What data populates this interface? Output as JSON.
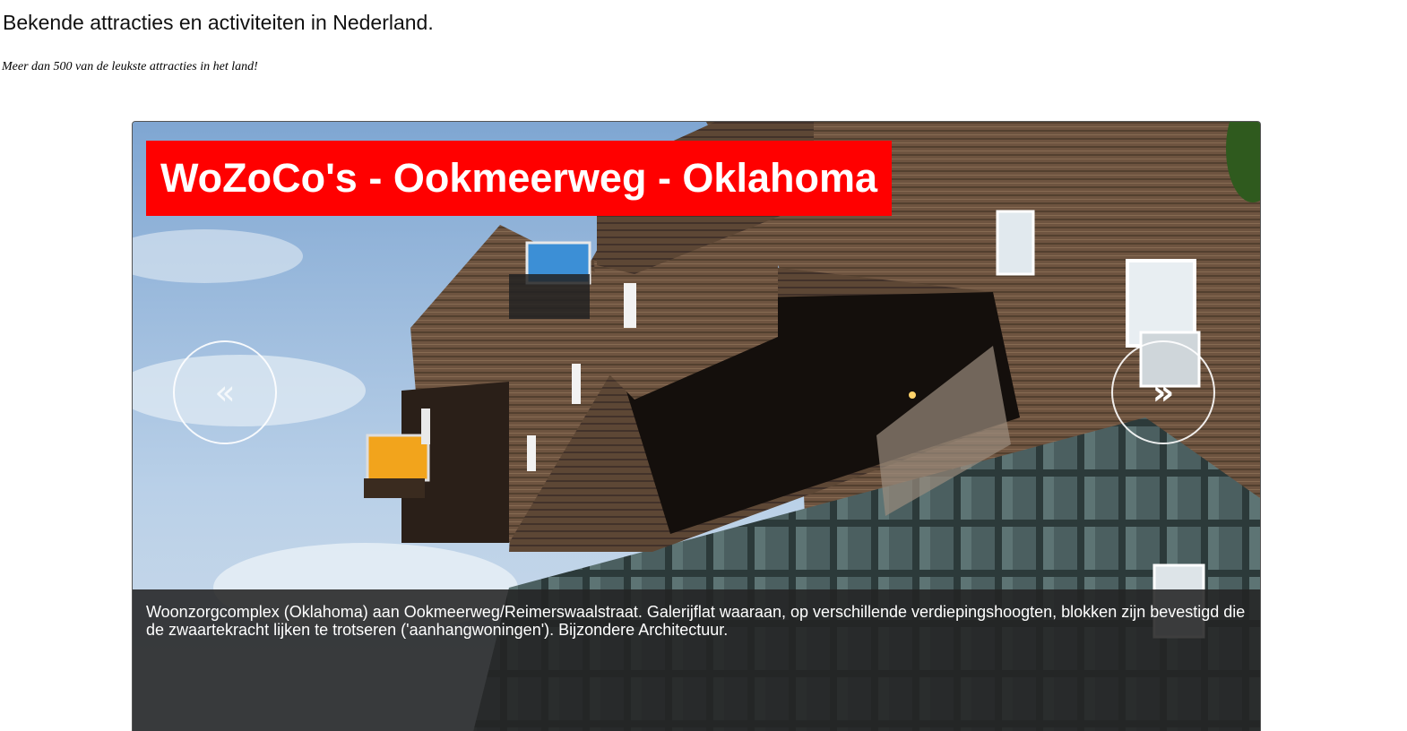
{
  "header": {
    "title": "Bekende attracties en activiteiten in Nederland.",
    "subtitle": "Meer dan 500 van de leukste attracties in het land!"
  },
  "slider": {
    "slide_title": "WoZoCo's - Ookmeerweg - Oklahoma",
    "caption": "Woonzorgcomplex (Oklahoma) aan Ookmeerweg/Reimerswaalstraat. Galerijflat waaraan, op verschillende verdiepingshoogten, blokken zijn bevestigd die de zwaartekracht lijken te trotseren ('aanhangwoningen'). Bijzondere Architectuur.",
    "prev_icon": "«",
    "next_icon": "»",
    "title_bg_color": "#ff0000"
  }
}
